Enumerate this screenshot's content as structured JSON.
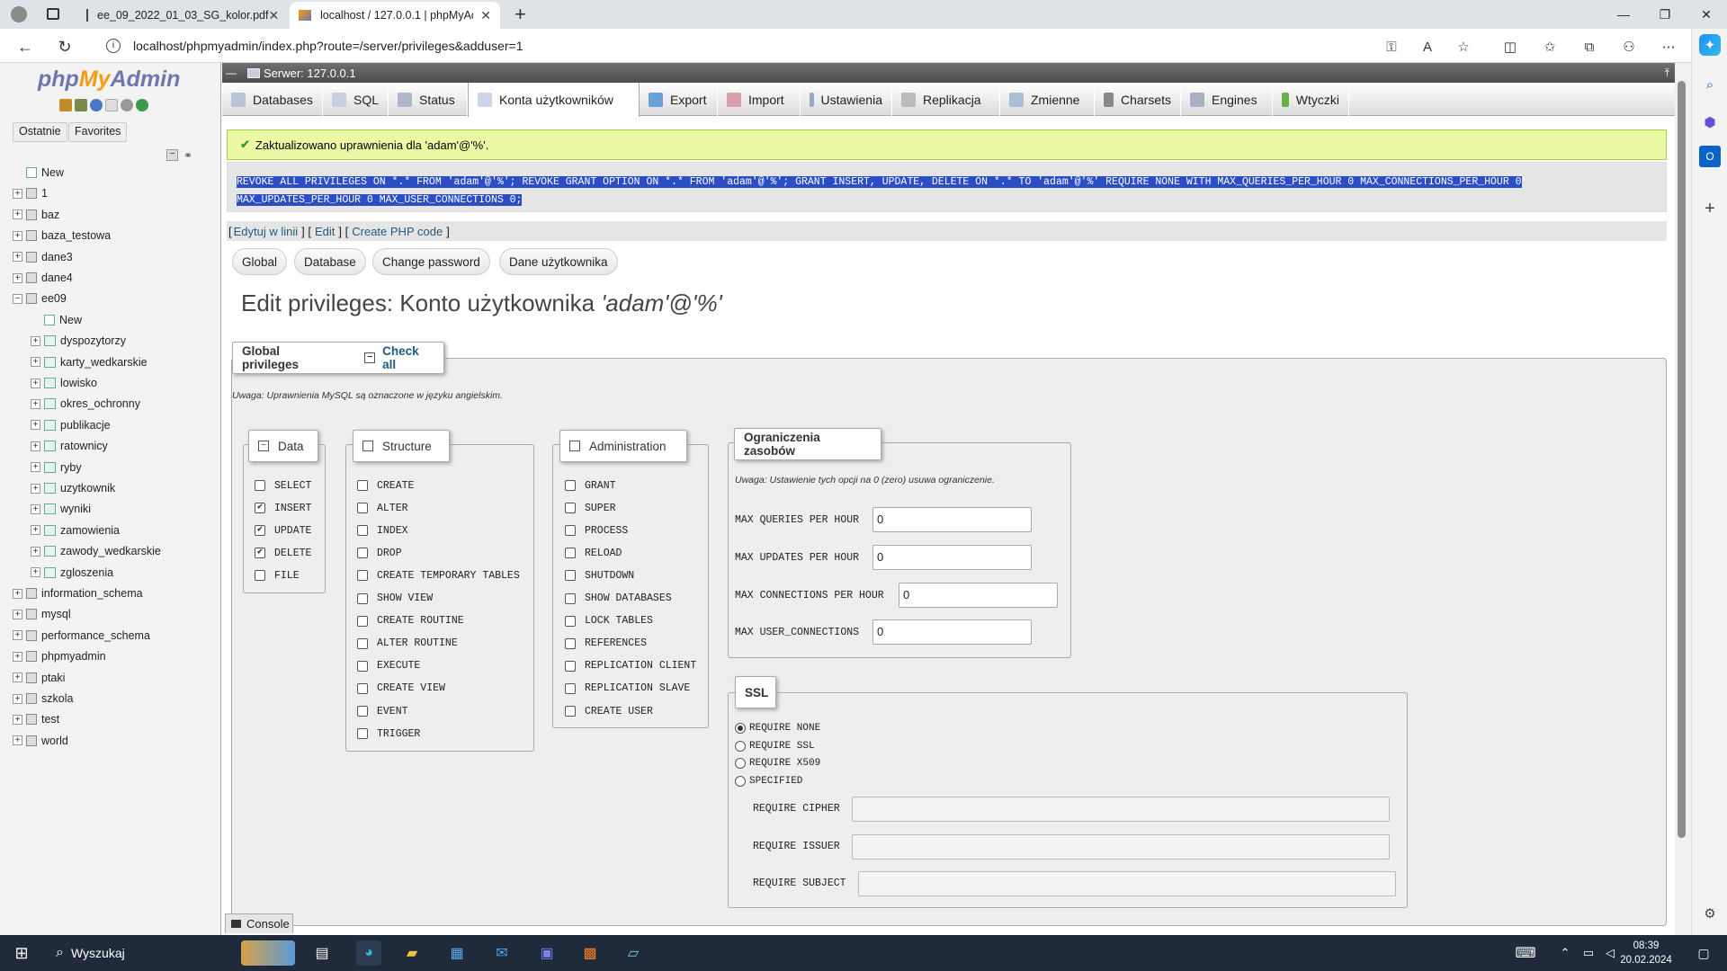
{
  "browser": {
    "tabs": [
      {
        "label": "ee_09_2022_01_03_SG_kolor.pdf",
        "active": false
      },
      {
        "label": "localhost / 127.0.0.1 | phpMyAdm",
        "active": true
      }
    ],
    "url": "localhost/phpmyadmin/index.php?route=/server/privileges&adduser=1",
    "new_tab": "+"
  },
  "sidebar": {
    "logo_php": "php",
    "logo_my": "My",
    "logo_admin": "Admin",
    "recent_label": "Ostatnie",
    "favorites_label": "Favorites",
    "tree": [
      {
        "label": "New",
        "level": 0,
        "type": "new"
      },
      {
        "label": "1",
        "level": 0,
        "type": "db"
      },
      {
        "label": "baz",
        "level": 0,
        "type": "db"
      },
      {
        "label": "baza_testowa",
        "level": 0,
        "type": "db"
      },
      {
        "label": "dane3",
        "level": 0,
        "type": "db"
      },
      {
        "label": "dane4",
        "level": 0,
        "type": "db"
      },
      {
        "label": "ee09",
        "level": 0,
        "type": "db-open"
      },
      {
        "label": "New",
        "level": 1,
        "type": "new"
      },
      {
        "label": "dyspozytorzy",
        "level": 1,
        "type": "table"
      },
      {
        "label": "karty_wedkarskie",
        "level": 1,
        "type": "table"
      },
      {
        "label": "lowisko",
        "level": 1,
        "type": "table"
      },
      {
        "label": "okres_ochronny",
        "level": 1,
        "type": "table"
      },
      {
        "label": "publikacje",
        "level": 1,
        "type": "table"
      },
      {
        "label": "ratownicy",
        "level": 1,
        "type": "table"
      },
      {
        "label": "ryby",
        "level": 1,
        "type": "table"
      },
      {
        "label": "uzytkownik",
        "level": 1,
        "type": "table"
      },
      {
        "label": "wyniki",
        "level": 1,
        "type": "table"
      },
      {
        "label": "zamowienia",
        "level": 1,
        "type": "table"
      },
      {
        "label": "zawody_wedkarskie",
        "level": 1,
        "type": "table"
      },
      {
        "label": "zgloszenia",
        "level": 1,
        "type": "table"
      },
      {
        "label": "information_schema",
        "level": 0,
        "type": "db"
      },
      {
        "label": "mysql",
        "level": 0,
        "type": "db"
      },
      {
        "label": "performance_schema",
        "level": 0,
        "type": "db"
      },
      {
        "label": "phpmyadmin",
        "level": 0,
        "type": "db"
      },
      {
        "label": "ptaki",
        "level": 0,
        "type": "db"
      },
      {
        "label": "szkola",
        "level": 0,
        "type": "db"
      },
      {
        "label": "test",
        "level": 0,
        "type": "db"
      },
      {
        "label": "world",
        "level": 0,
        "type": "db"
      }
    ]
  },
  "server_bar": "Serwer: 127.0.0.1",
  "topmenu": [
    {
      "label": "Databases"
    },
    {
      "label": "SQL"
    },
    {
      "label": "Status"
    },
    {
      "label": "Konta użytkowników"
    },
    {
      "label": "Export"
    },
    {
      "label": "Import"
    },
    {
      "label": "Ustawienia"
    },
    {
      "label": "Replikacja"
    },
    {
      "label": "Zmienne"
    },
    {
      "label": "Charsets"
    },
    {
      "label": "Engines"
    },
    {
      "label": "Wtyczki"
    }
  ],
  "success_message": "Zaktualizowano uprawnienia dla 'adam'@'%'.",
  "sql_query_line1": "REVOKE ALL PRIVILEGES ON *.* FROM 'adam'@'%'; REVOKE GRANT OPTION ON *.* FROM 'adam'@'%'; GRANT INSERT, UPDATE, DELETE ON *.* TO 'adam'@'%' REQUIRE NONE WITH MAX_QUERIES_PER_HOUR 0 MAX_CONNECTIONS_PER_HOUR 0",
  "sql_query_line2": "MAX_UPDATES_PER_HOUR 0 MAX_USER_CONNECTIONS 0;",
  "sql_links": {
    "open1": "[",
    "inline": "Edytuj w linii",
    "sep1": "] [",
    "edit": "Edit",
    "sep2": "] [",
    "php": "Create PHP code",
    "close": "]"
  },
  "subtabs": [
    "Global",
    "Database",
    "Change password",
    "Dane użytkownika"
  ],
  "page_title_prefix": "Edit privileges: Konto użytkownika ",
  "page_title_user": "'adam'@'%'",
  "global_privileges_legend": "Global privileges",
  "check_all_label": "Check all",
  "note_mysql": "Uwaga: Uprawnienia MySQL są oznaczone w języku angielskim.",
  "groups": {
    "data": {
      "title": "Data",
      "items": [
        {
          "label": "SELECT",
          "checked": false
        },
        {
          "label": "INSERT",
          "checked": true
        },
        {
          "label": "UPDATE",
          "checked": true
        },
        {
          "label": "DELETE",
          "checked": true
        },
        {
          "label": "FILE",
          "checked": false
        }
      ]
    },
    "structure": {
      "title": "Structure",
      "items": [
        {
          "label": "CREATE",
          "checked": false
        },
        {
          "label": "ALTER",
          "checked": false
        },
        {
          "label": "INDEX",
          "checked": false
        },
        {
          "label": "DROP",
          "checked": false
        },
        {
          "label": "CREATE TEMPORARY TABLES",
          "checked": false
        },
        {
          "label": "SHOW VIEW",
          "checked": false
        },
        {
          "label": "CREATE ROUTINE",
          "checked": false
        },
        {
          "label": "ALTER ROUTINE",
          "checked": false
        },
        {
          "label": "EXECUTE",
          "checked": false
        },
        {
          "label": "CREATE VIEW",
          "checked": false
        },
        {
          "label": "EVENT",
          "checked": false
        },
        {
          "label": "TRIGGER",
          "checked": false
        }
      ]
    },
    "administration": {
      "title": "Administration",
      "items": [
        {
          "label": "GRANT",
          "checked": false
        },
        {
          "label": "SUPER",
          "checked": false
        },
        {
          "label": "PROCESS",
          "checked": false
        },
        {
          "label": "RELOAD",
          "checked": false
        },
        {
          "label": "SHUTDOWN",
          "checked": false
        },
        {
          "label": "SHOW DATABASES",
          "checked": false
        },
        {
          "label": "LOCK TABLES",
          "checked": false
        },
        {
          "label": "REFERENCES",
          "checked": false
        },
        {
          "label": "REPLICATION CLIENT",
          "checked": false
        },
        {
          "label": "REPLICATION SLAVE",
          "checked": false
        },
        {
          "label": "CREATE USER",
          "checked": false
        }
      ]
    }
  },
  "limits": {
    "title": "Ograniczenia zasobów",
    "note": "Uwaga: Ustawienie tych opcji na 0 (zero) usuwa ograniczenie.",
    "fields": [
      {
        "label": "MAX QUERIES PER HOUR",
        "value": "0"
      },
      {
        "label": "MAX UPDATES PER HOUR",
        "value": "0"
      },
      {
        "label": "MAX CONNECTIONS PER HOUR",
        "value": "0"
      },
      {
        "label": "MAX USER_CONNECTIONS",
        "value": "0"
      }
    ]
  },
  "ssl": {
    "title": "SSL",
    "options": [
      {
        "label": "REQUIRE NONE",
        "selected": true
      },
      {
        "label": "REQUIRE SSL",
        "selected": false
      },
      {
        "label": "REQUIRE X509",
        "selected": false
      },
      {
        "label": "SPECIFIED",
        "selected": false
      }
    ],
    "fields": [
      {
        "label": "REQUIRE CIPHER",
        "value": ""
      },
      {
        "label": "REQUIRE ISSUER",
        "value": ""
      },
      {
        "label": "REQUIRE SUBJECT",
        "value": ""
      }
    ]
  },
  "console_label": "Console",
  "taskbar": {
    "search_label": "Wyszukaj",
    "time": "08:39",
    "date": "20.02.2024"
  }
}
